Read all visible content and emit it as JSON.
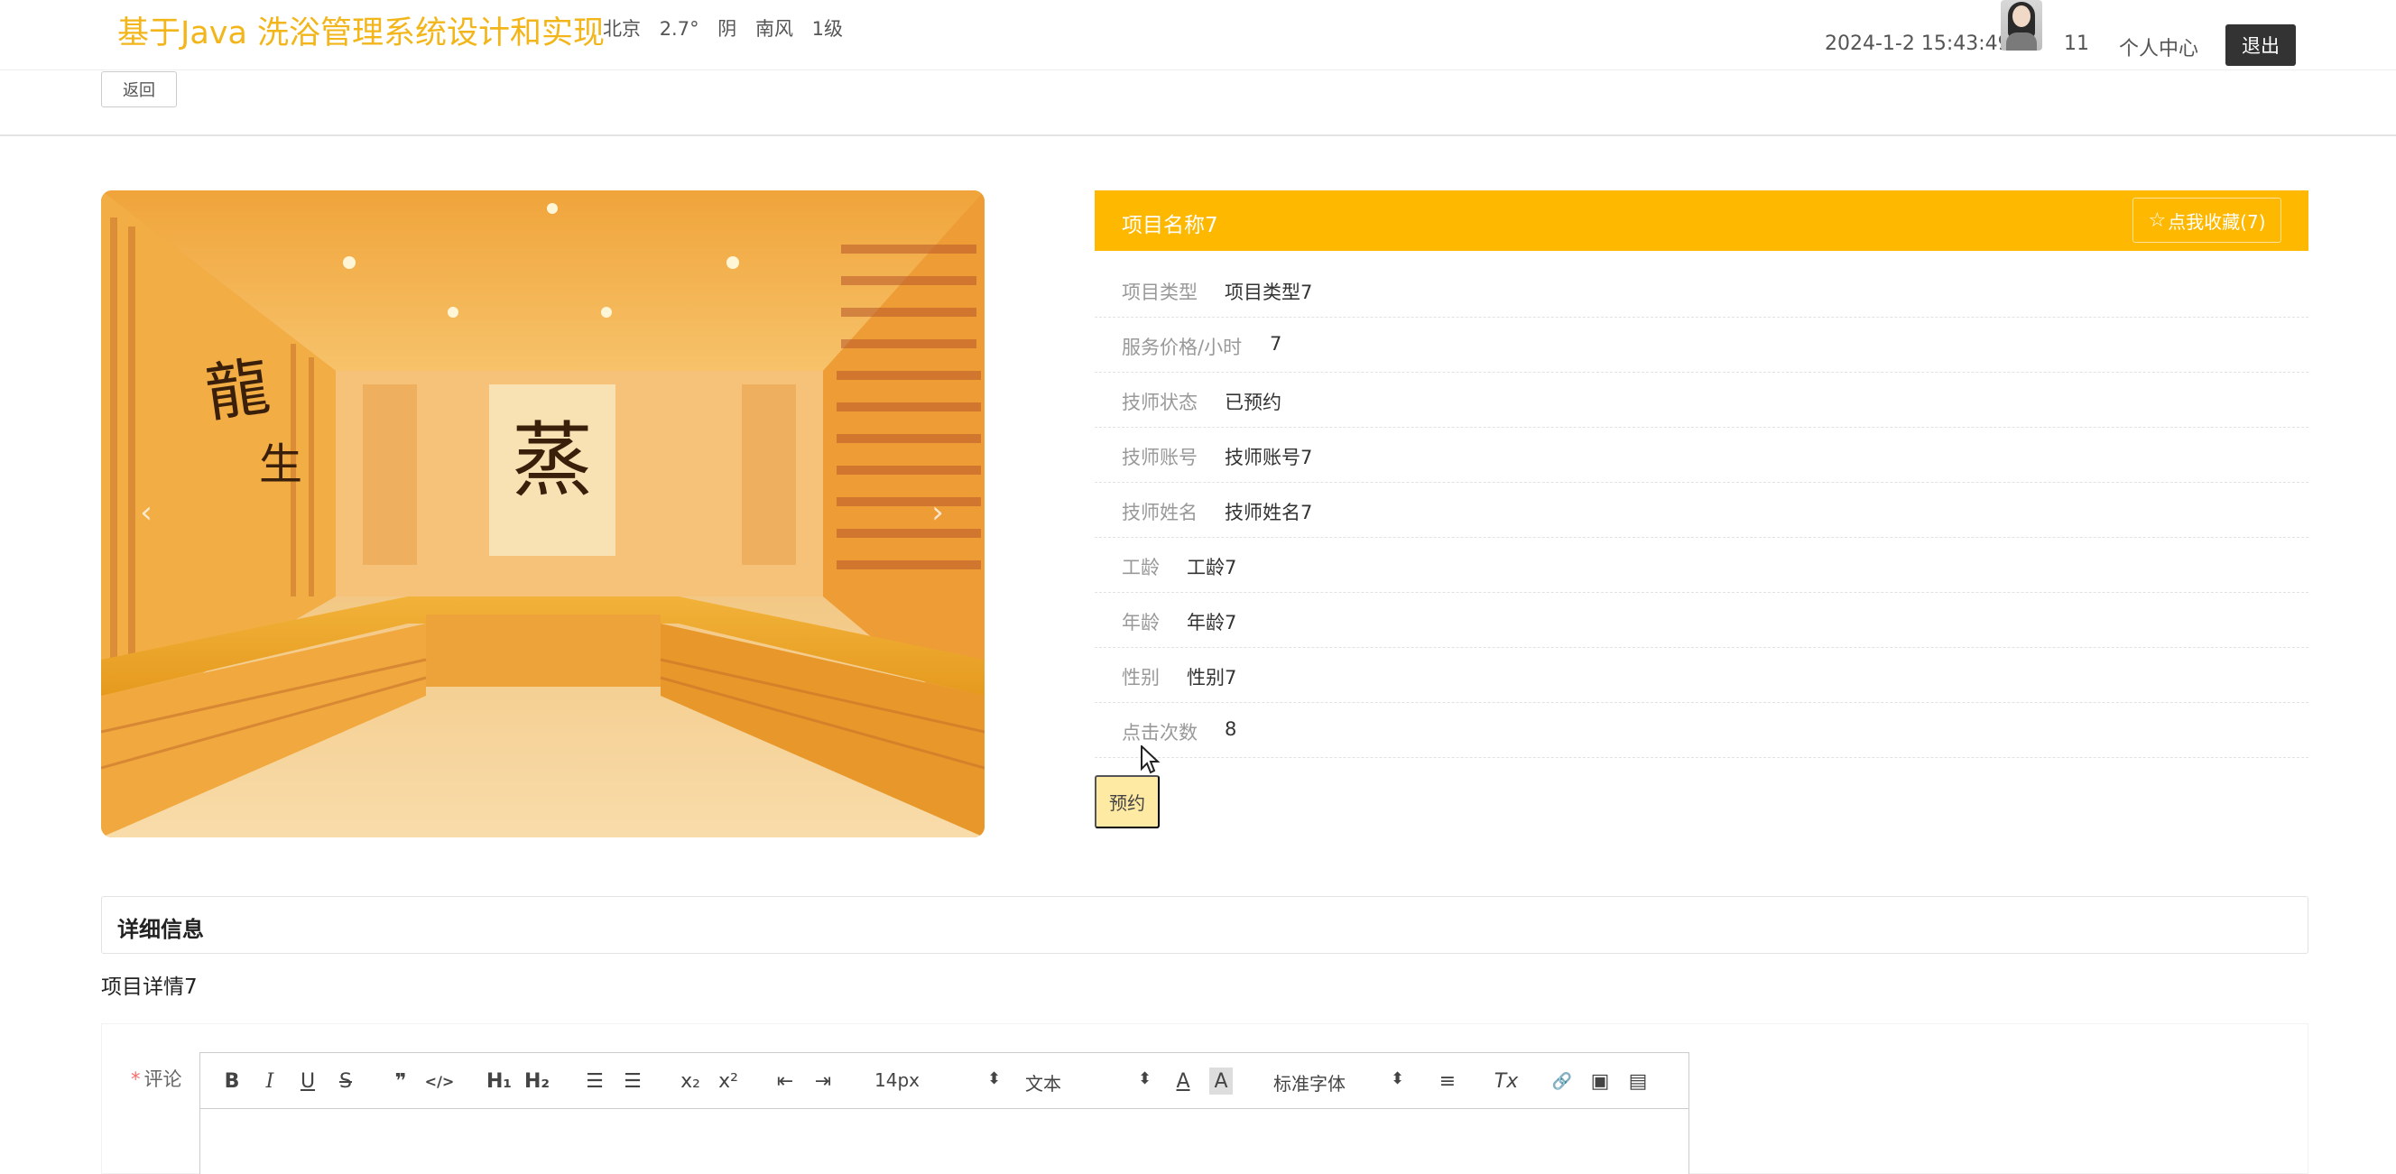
{
  "header": {
    "site_title": "基于Java 洗浴管理系统设计和实现",
    "weather": {
      "city": "北京",
      "temperature": "2.7°",
      "condition": "阴",
      "wind_direction": "南风",
      "wind_level": "1级"
    },
    "datetime": "2024-1-2 15:43:49",
    "username": "11",
    "personal_center": "个人中心",
    "logout": "退出"
  },
  "back_button": "返回",
  "carousel": {
    "prev_arrow": "‹",
    "next_arrow": "›",
    "slide_count": 3,
    "active_slide": 1
  },
  "detail": {
    "title": "项目名称7",
    "favorite_button": "点我收藏(7)",
    "attributes": [
      {
        "label": "项目类型",
        "value": "项目类型7"
      },
      {
        "label": "服务价格/小时",
        "value": "7"
      },
      {
        "label": "技师状态",
        "value": "已预约"
      },
      {
        "label": "技师账号",
        "value": "技师账号7"
      },
      {
        "label": "技师姓名",
        "value": "技师姓名7"
      },
      {
        "label": "工龄",
        "value": "工龄7"
      },
      {
        "label": "年龄",
        "value": "年龄7"
      },
      {
        "label": "性别",
        "value": "性别7"
      },
      {
        "label": "点击次数",
        "value": "8"
      }
    ],
    "reserve_button": "预约"
  },
  "info_section": {
    "title": "详细信息",
    "content": "项目详情7"
  },
  "comment": {
    "required_mark": "*",
    "label": "评论",
    "toolbar": {
      "bold": "B",
      "italic": "I",
      "underline": "U",
      "strike": "S",
      "quote": "❞",
      "code": "</>",
      "h1": "H₁",
      "h2": "H₂",
      "ordered_list": "☰",
      "bullet_list": "☰",
      "subscript": "x₂",
      "superscript": "x²",
      "outdent": "⇤",
      "indent": "⇥",
      "font_size": "14px",
      "heading_select": "文本",
      "font_family": "标准字体",
      "color": "A",
      "background": "A",
      "align": "≡",
      "clean": "Tx",
      "link": "🔗",
      "image": "▣",
      "video": "▤"
    }
  }
}
